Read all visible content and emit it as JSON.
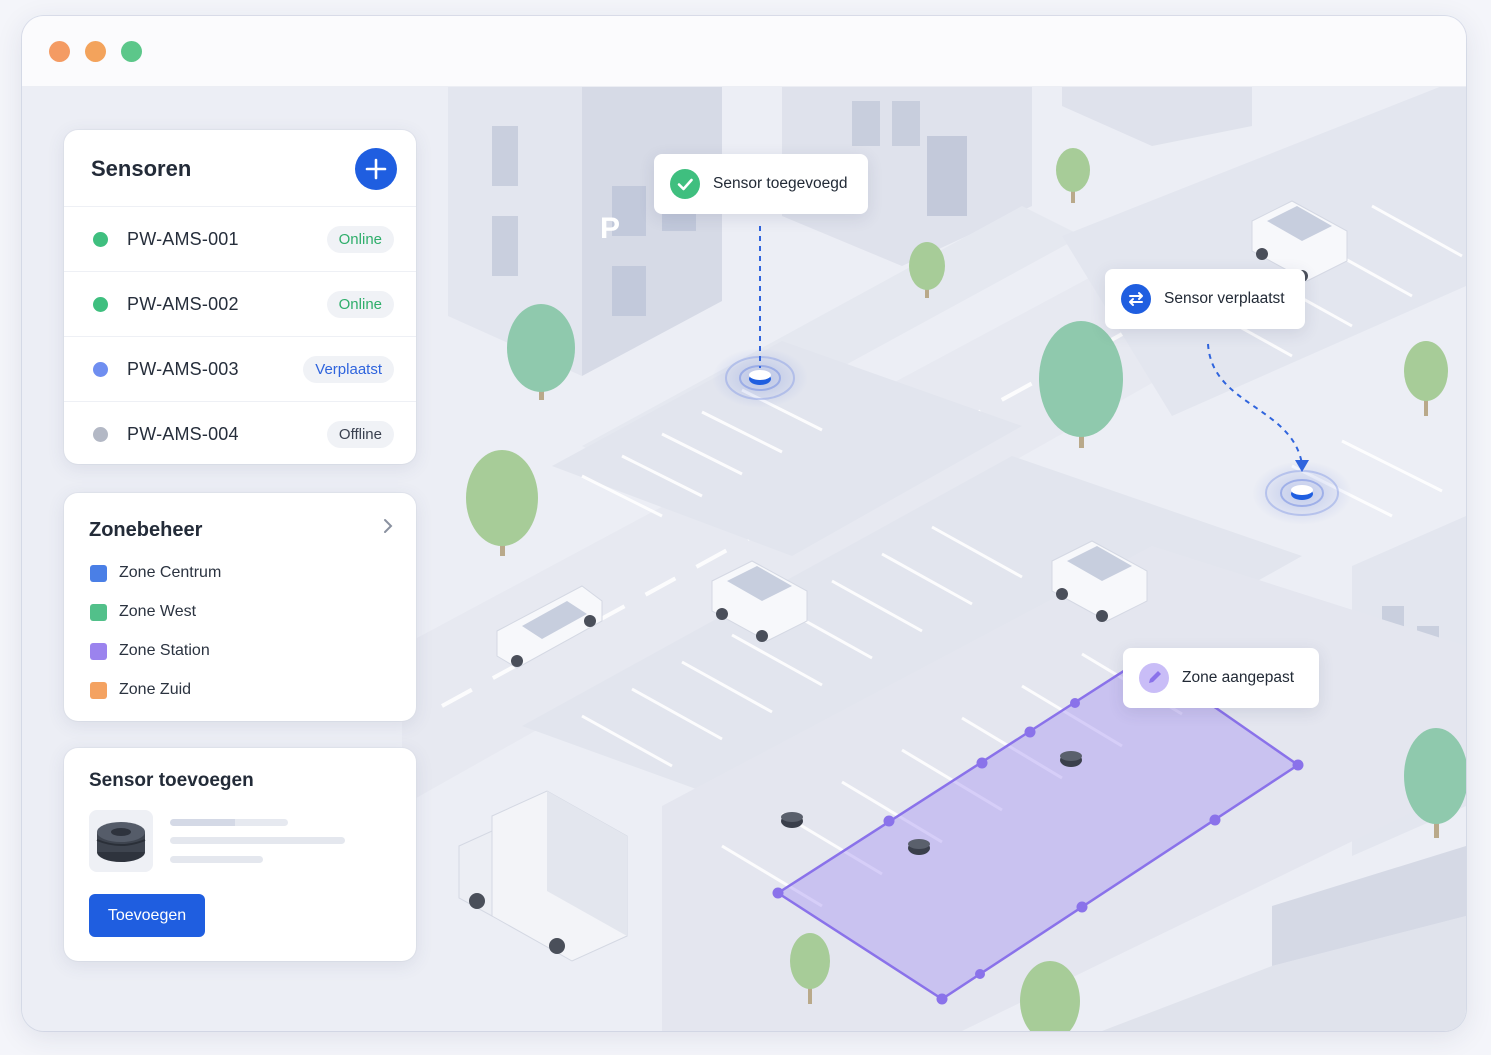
{
  "window": {
    "controls": [
      "close",
      "minimize",
      "maximize"
    ],
    "colors": {
      "close": "#f49b63",
      "minimize": "#f3a35c",
      "maximize": "#5cc78a"
    }
  },
  "sensors": {
    "title": "Sensoren",
    "add_icon": "plus-icon",
    "items": [
      {
        "id": "PW-AMS-001",
        "status": "Online",
        "dot_color": "#3fbf7f",
        "badge_color": "#2fae6b"
      },
      {
        "id": "PW-AMS-002",
        "status": "Online",
        "dot_color": "#3fbf7f",
        "badge_color": "#2fae6b"
      },
      {
        "id": "PW-AMS-003",
        "status": "Verplaatst",
        "dot_color": "#6f8ef0",
        "badge_color": "#2f64dd"
      },
      {
        "id": "PW-AMS-004",
        "status": "Offline",
        "dot_color": "#b3b8c5",
        "badge_color": "#3a4150"
      }
    ]
  },
  "zones": {
    "title": "Zonebeheer",
    "items": [
      {
        "label": "Zone Centrum",
        "color": "#4a7fe6"
      },
      {
        "label": "Zone West",
        "color": "#52c08a"
      },
      {
        "label": "Zone Station",
        "color": "#9b83ee"
      },
      {
        "label": "Zone Zuid",
        "color": "#f4a261"
      }
    ]
  },
  "add_sensor": {
    "title": "Sensor toevoegen",
    "button_label": "Toevoegen"
  },
  "map": {
    "parking_sign": "P",
    "notifications": [
      {
        "text": "Sensor toegevoegd",
        "icon": "check-icon",
        "color": "#3fbf7f"
      },
      {
        "text": "Sensor verplaatst",
        "icon": "swap-arrows-icon",
        "color": "#1f5ee0"
      },
      {
        "text": "Zone aangepast",
        "icon": "pencil-icon",
        "color": "#9b83ee"
      }
    ]
  },
  "colors": {
    "accent": "#1f5ee0",
    "zone_overlay": "#a996f2"
  }
}
